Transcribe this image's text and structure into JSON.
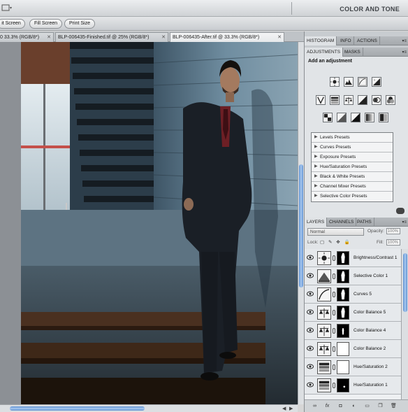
{
  "workspace": {
    "label": "COLOR AND TONE"
  },
  "options_bar": {
    "buttons": [
      "it Screen",
      "Fill Screen",
      "Print Size"
    ]
  },
  "document_tabs": [
    {
      "label": "0 33.3% (RGB/8*)",
      "active": false
    },
    {
      "label": "BLP-006435-Finished.tif @ 25% (RGB/8*)",
      "active": false
    },
    {
      "label": "BLP-006435-After.tif @ 33.3% (RGB/8*)",
      "active": true
    }
  ],
  "panel_tabs_top": [
    "HISTOGRAM",
    "INFO",
    "ACTIONS"
  ],
  "panel_tabs_adjust": [
    "ADJUSTMENTS",
    "MASKS"
  ],
  "adjustments": {
    "title": "Add an adjustment",
    "presets": [
      "Levels Presets",
      "Curves Presets",
      "Exposure Presets",
      "Hue/Saturation Presets",
      "Black & White Presets",
      "Channel Mixer Presets",
      "Selective Color Presets"
    ]
  },
  "panel_tabs_layers": [
    "LAYERS",
    "CHANNELS",
    "PATHS"
  ],
  "layers_options": {
    "blend_mode": "Normal",
    "opacity_label": "Opacity:",
    "opacity_value": "100%",
    "lock_label": "Lock:",
    "fill_label": "Fill:",
    "fill_value": "100%"
  },
  "layers": [
    {
      "name": "Brightness/Contrast 1",
      "icon": "brightness-icon",
      "mask": "figure"
    },
    {
      "name": "Selective Color 1",
      "icon": "selective-color-icon",
      "mask": "figure"
    },
    {
      "name": "Curves 5",
      "icon": "curves-icon",
      "mask": "figure"
    },
    {
      "name": "Color Balance 5",
      "icon": "balance-icon",
      "mask": "figure"
    },
    {
      "name": "Color Balance 4",
      "icon": "balance-icon",
      "mask": "figure-small"
    },
    {
      "name": "Color Balance 2",
      "icon": "balance-icon",
      "mask": "white"
    },
    {
      "name": "Hue/Saturation 2",
      "icon": "hue-icon",
      "mask": "white"
    },
    {
      "name": "Hue/Saturation 1",
      "icon": "hue-icon",
      "mask": "dot"
    }
  ]
}
